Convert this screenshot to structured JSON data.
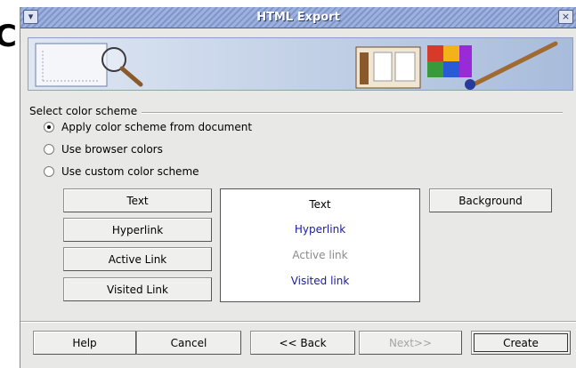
{
  "stray_glyph": "C",
  "window": {
    "title": "HTML Export",
    "menu_glyph": "▾",
    "close_glyph": "×"
  },
  "color_scheme": {
    "section_label": "Select color scheme",
    "options": [
      {
        "label": "Apply color scheme from document",
        "checked": true
      },
      {
        "label": "Use browser colors",
        "checked": false
      },
      {
        "label": "Use custom color scheme",
        "checked": false
      }
    ]
  },
  "color_buttons": {
    "text": "Text",
    "hyperlink": "Hyperlink",
    "active_link": "Active Link",
    "visited_link": "Visited Link",
    "background": "Background"
  },
  "preview": {
    "text": "Text",
    "hyperlink": "Hyperlink",
    "active_link": "Active link",
    "visited_link": "Visited link",
    "colors": {
      "text": "#000000",
      "hyperlink": "#1a1aa6",
      "active": "#8a8a8a",
      "visited": "#1a1aa6"
    }
  },
  "footer": {
    "help": "Help",
    "cancel": "Cancel",
    "back": "<< Back",
    "next": "Next>>",
    "create": "Create"
  },
  "icons": [
    "menu-icon",
    "close-icon",
    "magnifier-icon",
    "document-icon",
    "color-palette-icon",
    "paintbrush-icon"
  ]
}
